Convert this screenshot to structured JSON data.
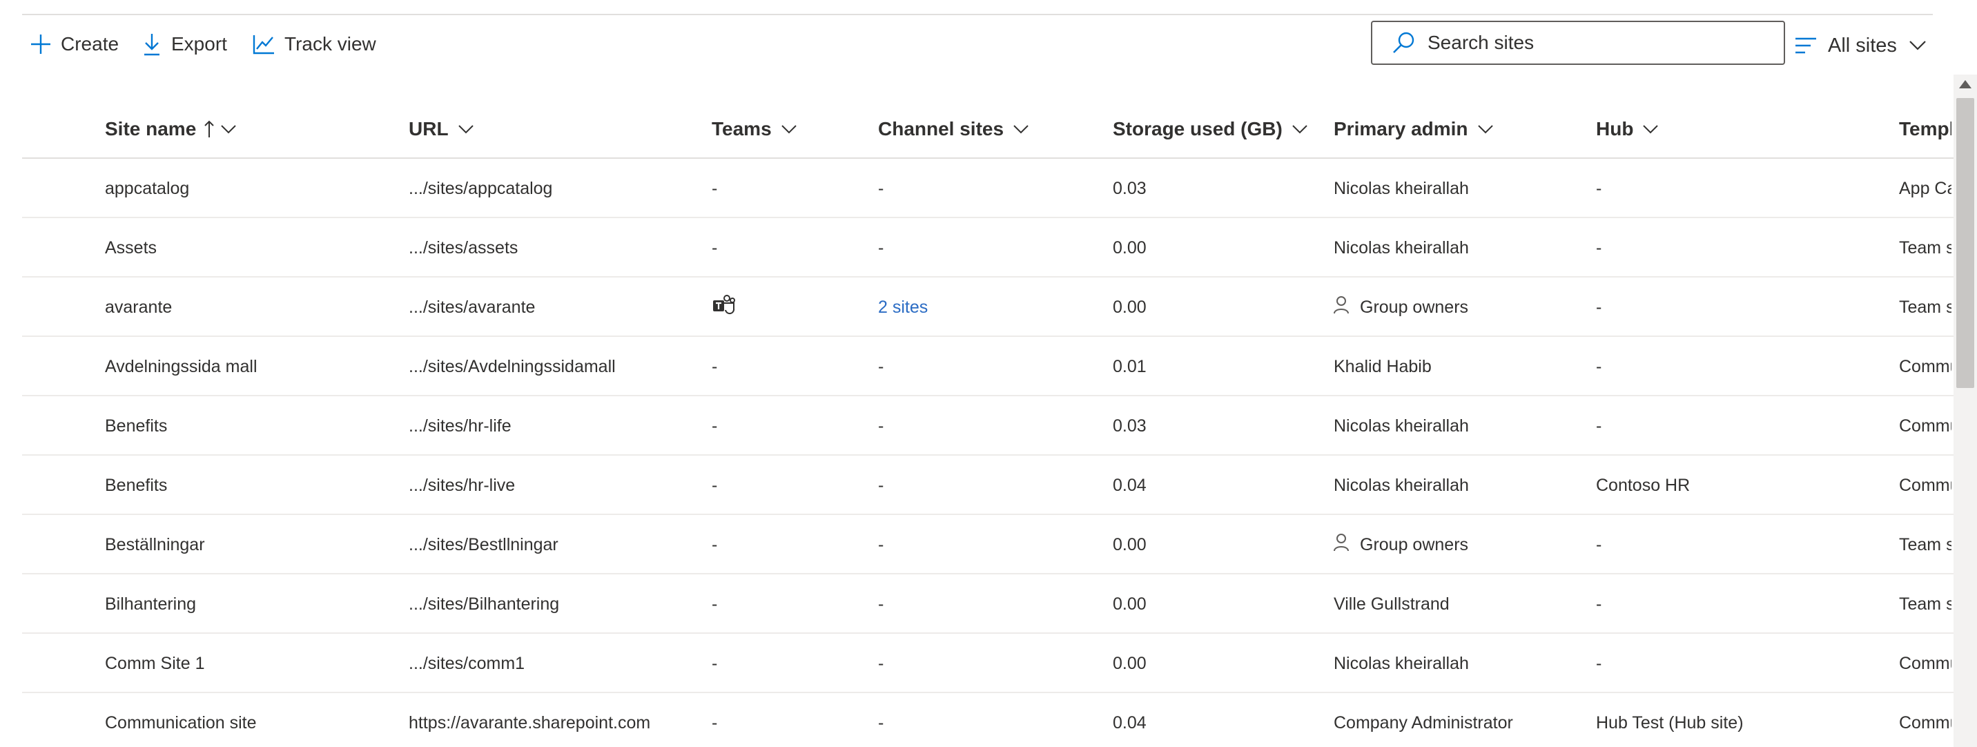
{
  "toolbar": {
    "create_label": "Create",
    "export_label": "Export",
    "track_label": "Track view"
  },
  "search": {
    "placeholder": "Search sites"
  },
  "filter": {
    "label": "All sites"
  },
  "colors": {
    "link": "#2b6cc4",
    "accent": "#0078d4",
    "text": "#323130",
    "divider": "#edebe9"
  },
  "table": {
    "columns": {
      "name": "Site name",
      "url": "URL",
      "teams": "Teams",
      "channel": "Channel sites",
      "storage": "Storage used (GB)",
      "admin": "Primary admin",
      "hub": "Hub",
      "template": "Templ"
    },
    "sort": {
      "column": "Site name",
      "direction": "ascending"
    },
    "rows": [
      {
        "name": "appcatalog",
        "url": ".../sites/appcatalog",
        "teams": "-",
        "channel": "-",
        "storage": "0.03",
        "admin": "Nicolas kheirallah",
        "admin_is_group": false,
        "hub": "-",
        "template": "App Ca"
      },
      {
        "name": "Assets",
        "url": ".../sites/assets",
        "teams": "-",
        "channel": "-",
        "storage": "0.00",
        "admin": "Nicolas kheirallah",
        "admin_is_group": false,
        "hub": "-",
        "template": "Team si"
      },
      {
        "name": "avarante",
        "url": ".../sites/avarante",
        "teams": "teams-icon",
        "channel": "2 sites",
        "storage": "0.00",
        "admin": "Group owners",
        "admin_is_group": true,
        "hub": "-",
        "template": "Team si"
      },
      {
        "name": "Avdelningssida mall",
        "url": ".../sites/Avdelningssidamall",
        "teams": "-",
        "channel": "-",
        "storage": "0.01",
        "admin": "Khalid Habib",
        "admin_is_group": false,
        "hub": "-",
        "template": "Commu"
      },
      {
        "name": "Benefits",
        "url": ".../sites/hr-life",
        "teams": "-",
        "channel": "-",
        "storage": "0.03",
        "admin": "Nicolas kheirallah",
        "admin_is_group": false,
        "hub": "-",
        "template": "Commu"
      },
      {
        "name": "Benefits",
        "url": ".../sites/hr-live",
        "teams": "-",
        "channel": "-",
        "storage": "0.04",
        "admin": "Nicolas kheirallah",
        "admin_is_group": false,
        "hub": "Contoso HR",
        "template": "Commu"
      },
      {
        "name": "Beställningar",
        "url": ".../sites/Bestllningar",
        "teams": "-",
        "channel": "-",
        "storage": "0.00",
        "admin": "Group owners",
        "admin_is_group": true,
        "hub": "-",
        "template": "Team si"
      },
      {
        "name": "Bilhantering",
        "url": ".../sites/Bilhantering",
        "teams": "-",
        "channel": "-",
        "storage": "0.00",
        "admin": "Ville Gullstrand",
        "admin_is_group": false,
        "hub": "-",
        "template": "Team si"
      },
      {
        "name": "Comm Site 1",
        "url": ".../sites/comm1",
        "teams": "-",
        "channel": "-",
        "storage": "0.00",
        "admin": "Nicolas kheirallah",
        "admin_is_group": false,
        "hub": "-",
        "template": "Commu"
      },
      {
        "name": "Communication site",
        "url": "https://avarante.sharepoint.com",
        "teams": "-",
        "channel": "-",
        "storage": "0.04",
        "admin": "Company Administrator",
        "admin_is_group": false,
        "hub": "Hub Test (Hub site)",
        "template": "Commu"
      }
    ]
  }
}
